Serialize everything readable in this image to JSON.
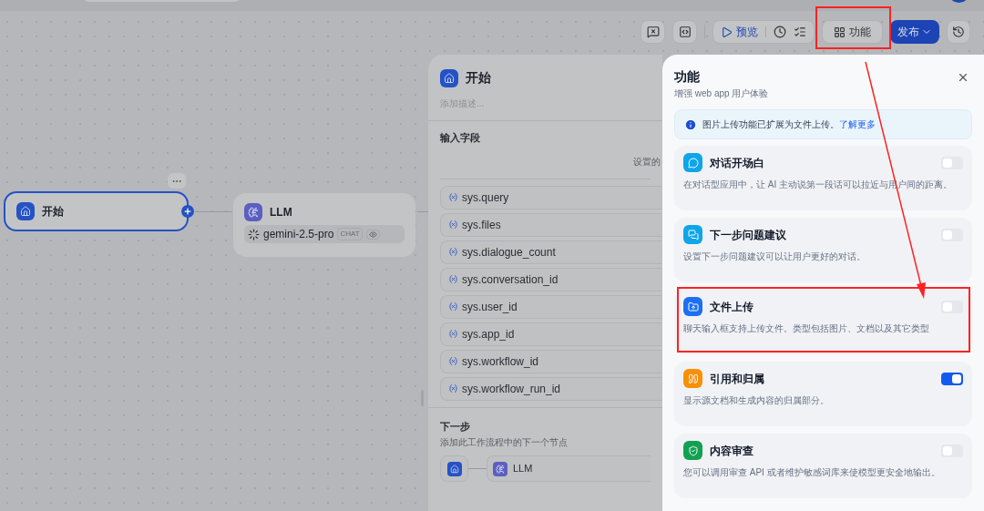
{
  "toolbar": {
    "preview": "预览",
    "features": "功能",
    "publish": "发布"
  },
  "canvas": {
    "nodes": [
      {
        "kind": "start",
        "title": "开始",
        "selected": true
      },
      {
        "kind": "llm",
        "title": "LLM",
        "model": "gemini-2.5-pro",
        "mode": "CHAT",
        "selected": false
      }
    ]
  },
  "start_panel": {
    "title": "开始",
    "description_placeholder": "添加描述...",
    "input_section": "输入字段",
    "input_hint": "设置的",
    "variables": [
      "sys.query",
      "sys.files",
      "sys.dialogue_count",
      "sys.conversation_id",
      "sys.user_id",
      "sys.app_id",
      "sys.workflow_id",
      "sys.workflow_run_id"
    ],
    "next_step": {
      "title": "下一步",
      "description": "添加此工作流程中的下一个节点",
      "next_node": "LLM"
    }
  },
  "features_panel": {
    "title": "功能",
    "subtitle": "增强 web app 用户体验",
    "notice": {
      "text": "图片上传功能已扩展为文件上传。",
      "link": "了解更多"
    },
    "features": [
      {
        "kind": "opening",
        "title": "对话开场白",
        "description": "在对话型应用中，让 AI 主动说第一段话可以拉近与用户间的距离。",
        "on": false,
        "color": "#0ea5e9"
      },
      {
        "kind": "suggestion",
        "title": "下一步问题建议",
        "description": "设置下一步问题建议可以让用户更好的对话。",
        "on": false,
        "color": "#0ea5e9"
      },
      {
        "kind": "upload",
        "title": "文件上传",
        "description": "聊天输入框支持上传文件。类型包括图片、文档以及其它类型",
        "on": false,
        "color": "#1d6ff2"
      },
      {
        "kind": "citation",
        "title": "引用和归属",
        "description": "显示源文档和生成内容的归属部分。",
        "on": true,
        "color": "#f79009"
      },
      {
        "kind": "moderation",
        "title": "内容审查",
        "description": "您可以调用审查 API 或者维护敏感词库来使模型更安全地输出。",
        "on": false,
        "color": "#12a150"
      }
    ]
  }
}
